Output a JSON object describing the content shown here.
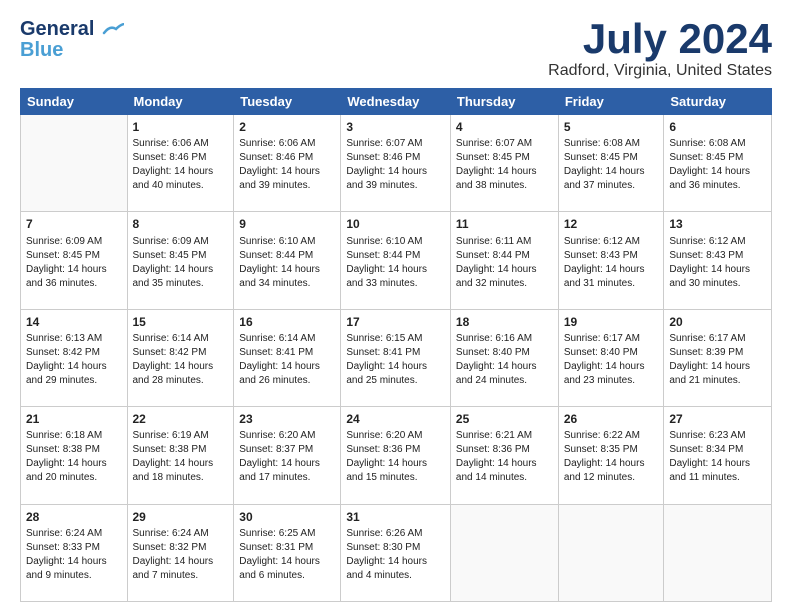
{
  "header": {
    "logo_line1": "General",
    "logo_line2": "Blue",
    "title": "July 2024",
    "location": "Radford, Virginia, United States"
  },
  "days_of_week": [
    "Sunday",
    "Monday",
    "Tuesday",
    "Wednesday",
    "Thursday",
    "Friday",
    "Saturday"
  ],
  "weeks": [
    [
      {
        "day": "",
        "sunrise": "",
        "sunset": "",
        "daylight": ""
      },
      {
        "day": "1",
        "sunrise": "Sunrise: 6:06 AM",
        "sunset": "Sunset: 8:46 PM",
        "daylight": "Daylight: 14 hours and 40 minutes."
      },
      {
        "day": "2",
        "sunrise": "Sunrise: 6:06 AM",
        "sunset": "Sunset: 8:46 PM",
        "daylight": "Daylight: 14 hours and 39 minutes."
      },
      {
        "day": "3",
        "sunrise": "Sunrise: 6:07 AM",
        "sunset": "Sunset: 8:46 PM",
        "daylight": "Daylight: 14 hours and 39 minutes."
      },
      {
        "day": "4",
        "sunrise": "Sunrise: 6:07 AM",
        "sunset": "Sunset: 8:45 PM",
        "daylight": "Daylight: 14 hours and 38 minutes."
      },
      {
        "day": "5",
        "sunrise": "Sunrise: 6:08 AM",
        "sunset": "Sunset: 8:45 PM",
        "daylight": "Daylight: 14 hours and 37 minutes."
      },
      {
        "day": "6",
        "sunrise": "Sunrise: 6:08 AM",
        "sunset": "Sunset: 8:45 PM",
        "daylight": "Daylight: 14 hours and 36 minutes."
      }
    ],
    [
      {
        "day": "7",
        "sunrise": "Sunrise: 6:09 AM",
        "sunset": "Sunset: 8:45 PM",
        "daylight": "Daylight: 14 hours and 36 minutes."
      },
      {
        "day": "8",
        "sunrise": "Sunrise: 6:09 AM",
        "sunset": "Sunset: 8:45 PM",
        "daylight": "Daylight: 14 hours and 35 minutes."
      },
      {
        "day": "9",
        "sunrise": "Sunrise: 6:10 AM",
        "sunset": "Sunset: 8:44 PM",
        "daylight": "Daylight: 14 hours and 34 minutes."
      },
      {
        "day": "10",
        "sunrise": "Sunrise: 6:10 AM",
        "sunset": "Sunset: 8:44 PM",
        "daylight": "Daylight: 14 hours and 33 minutes."
      },
      {
        "day": "11",
        "sunrise": "Sunrise: 6:11 AM",
        "sunset": "Sunset: 8:44 PM",
        "daylight": "Daylight: 14 hours and 32 minutes."
      },
      {
        "day": "12",
        "sunrise": "Sunrise: 6:12 AM",
        "sunset": "Sunset: 8:43 PM",
        "daylight": "Daylight: 14 hours and 31 minutes."
      },
      {
        "day": "13",
        "sunrise": "Sunrise: 6:12 AM",
        "sunset": "Sunset: 8:43 PM",
        "daylight": "Daylight: 14 hours and 30 minutes."
      }
    ],
    [
      {
        "day": "14",
        "sunrise": "Sunrise: 6:13 AM",
        "sunset": "Sunset: 8:42 PM",
        "daylight": "Daylight: 14 hours and 29 minutes."
      },
      {
        "day": "15",
        "sunrise": "Sunrise: 6:14 AM",
        "sunset": "Sunset: 8:42 PM",
        "daylight": "Daylight: 14 hours and 28 minutes."
      },
      {
        "day": "16",
        "sunrise": "Sunrise: 6:14 AM",
        "sunset": "Sunset: 8:41 PM",
        "daylight": "Daylight: 14 hours and 26 minutes."
      },
      {
        "day": "17",
        "sunrise": "Sunrise: 6:15 AM",
        "sunset": "Sunset: 8:41 PM",
        "daylight": "Daylight: 14 hours and 25 minutes."
      },
      {
        "day": "18",
        "sunrise": "Sunrise: 6:16 AM",
        "sunset": "Sunset: 8:40 PM",
        "daylight": "Daylight: 14 hours and 24 minutes."
      },
      {
        "day": "19",
        "sunrise": "Sunrise: 6:17 AM",
        "sunset": "Sunset: 8:40 PM",
        "daylight": "Daylight: 14 hours and 23 minutes."
      },
      {
        "day": "20",
        "sunrise": "Sunrise: 6:17 AM",
        "sunset": "Sunset: 8:39 PM",
        "daylight": "Daylight: 14 hours and 21 minutes."
      }
    ],
    [
      {
        "day": "21",
        "sunrise": "Sunrise: 6:18 AM",
        "sunset": "Sunset: 8:38 PM",
        "daylight": "Daylight: 14 hours and 20 minutes."
      },
      {
        "day": "22",
        "sunrise": "Sunrise: 6:19 AM",
        "sunset": "Sunset: 8:38 PM",
        "daylight": "Daylight: 14 hours and 18 minutes."
      },
      {
        "day": "23",
        "sunrise": "Sunrise: 6:20 AM",
        "sunset": "Sunset: 8:37 PM",
        "daylight": "Daylight: 14 hours and 17 minutes."
      },
      {
        "day": "24",
        "sunrise": "Sunrise: 6:20 AM",
        "sunset": "Sunset: 8:36 PM",
        "daylight": "Daylight: 14 hours and 15 minutes."
      },
      {
        "day": "25",
        "sunrise": "Sunrise: 6:21 AM",
        "sunset": "Sunset: 8:36 PM",
        "daylight": "Daylight: 14 hours and 14 minutes."
      },
      {
        "day": "26",
        "sunrise": "Sunrise: 6:22 AM",
        "sunset": "Sunset: 8:35 PM",
        "daylight": "Daylight: 14 hours and 12 minutes."
      },
      {
        "day": "27",
        "sunrise": "Sunrise: 6:23 AM",
        "sunset": "Sunset: 8:34 PM",
        "daylight": "Daylight: 14 hours and 11 minutes."
      }
    ],
    [
      {
        "day": "28",
        "sunrise": "Sunrise: 6:24 AM",
        "sunset": "Sunset: 8:33 PM",
        "daylight": "Daylight: 14 hours and 9 minutes."
      },
      {
        "day": "29",
        "sunrise": "Sunrise: 6:24 AM",
        "sunset": "Sunset: 8:32 PM",
        "daylight": "Daylight: 14 hours and 7 minutes."
      },
      {
        "day": "30",
        "sunrise": "Sunrise: 6:25 AM",
        "sunset": "Sunset: 8:31 PM",
        "daylight": "Daylight: 14 hours and 6 minutes."
      },
      {
        "day": "31",
        "sunrise": "Sunrise: 6:26 AM",
        "sunset": "Sunset: 8:30 PM",
        "daylight": "Daylight: 14 hours and 4 minutes."
      },
      {
        "day": "",
        "sunrise": "",
        "sunset": "",
        "daylight": ""
      },
      {
        "day": "",
        "sunrise": "",
        "sunset": "",
        "daylight": ""
      },
      {
        "day": "",
        "sunrise": "",
        "sunset": "",
        "daylight": ""
      }
    ]
  ]
}
